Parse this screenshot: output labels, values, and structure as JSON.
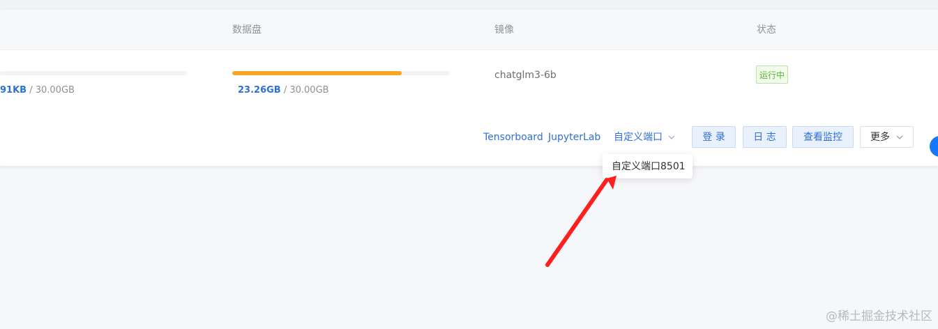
{
  "table": {
    "headers": {
      "data_disk": "数据盘",
      "image": "镜像",
      "status": "状态"
    },
    "row": {
      "system_disk": {
        "used": "91KB",
        "separator": " / ",
        "total": "30.00GB",
        "fill_fraction": 0.0
      },
      "data_disk": {
        "used": "23.26GB",
        "separator": " / ",
        "total": "30.00GB",
        "fill_fraction": 0.78
      },
      "image": "chatglm3-6b",
      "status": "运行中"
    }
  },
  "actions": {
    "tensorboard": "Tensorboard",
    "jupyterlab": "JupyterLab",
    "custom_port": "自定义端口",
    "login": "登 录",
    "logs": "日 志",
    "monitor": "查看监控",
    "more": "更多"
  },
  "dropdown": {
    "items": [
      "自定义端口8501"
    ]
  },
  "watermark": "@稀土掘金技术社区",
  "colors": {
    "accent": "#2f6fdb",
    "progress": "#f5a623",
    "status_green": "#55b43a",
    "annotation_red": "#ff1f1f"
  },
  "icons": {
    "chevron": "chevron-down-icon",
    "annotation": "red-arrow-icon"
  }
}
